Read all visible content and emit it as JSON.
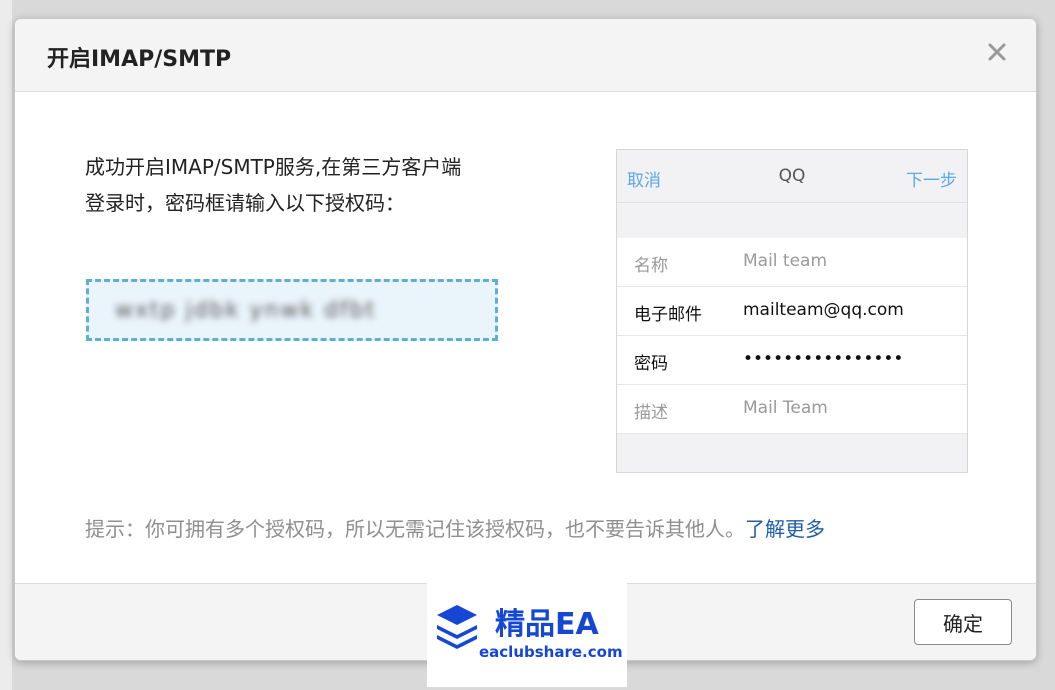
{
  "dialog": {
    "title": "开启IMAP/SMTP",
    "intro_line1": "成功开启IMAP/SMTP服务,在第三方客户端",
    "intro_line2": "登录时，密码框请输入以下授权码：",
    "auth_code_blurred": "wxtp jdbk ynwk dfbt",
    "hint": "提示：你可拥有多个授权码，所以无需记住该授权码，也不要告诉其他人。",
    "hint_link": "了解更多",
    "confirm_label": "确定"
  },
  "phone": {
    "nav": {
      "cancel": "取消",
      "title": "QQ",
      "next": "下一步"
    },
    "rows": [
      {
        "label": "名称",
        "value": "Mail team"
      },
      {
        "label": "电子邮件",
        "value": "mailteam@qq.com"
      },
      {
        "label": "密码",
        "value": "••••••••••••••••"
      },
      {
        "label": "描述",
        "value": "Mail Team"
      }
    ]
  },
  "watermark": {
    "title": "精品EA",
    "url": "eaclubshare.com"
  },
  "icons": {
    "close": "close-icon",
    "logo": "layers-logo-icon"
  },
  "colors": {
    "link": "#1e5fa8",
    "ios_blue": "#5aa8e8",
    "code_border": "#5fb0d0",
    "watermark_blue": "#1647d4"
  }
}
